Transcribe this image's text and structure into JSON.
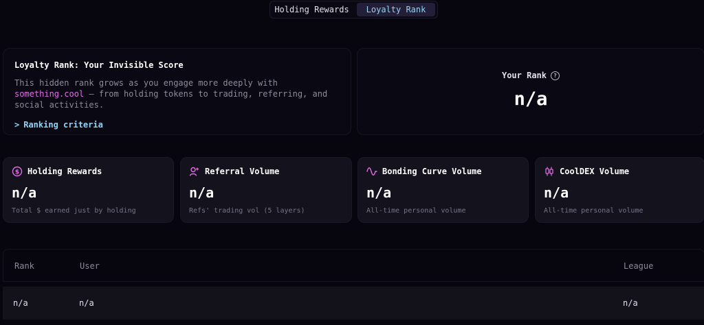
{
  "tabs": [
    {
      "label": "Holding Rewards",
      "active": false
    },
    {
      "label": "Loyalty Rank",
      "active": true
    }
  ],
  "intro": {
    "title": "Loyalty Rank: Your Invisible Score",
    "body_part1": "This hidden rank grows as you engage more deeply with ",
    "brand": "something.cool",
    "body_part2": " — from holding tokens to trading, referring, and social activities.",
    "criteria_prefix": ">",
    "criteria_label": "Ranking criteria"
  },
  "rank": {
    "label": "Your Rank",
    "help_icon": "?",
    "value": "n/a"
  },
  "stats": [
    {
      "icon": "dollar-circle-icon",
      "title": "Holding Rewards",
      "value": "n/a",
      "desc": "Total $ earned just by holding"
    },
    {
      "icon": "referral-user-icon",
      "title": "Referral Volume",
      "value": "n/a",
      "desc": "Refs' trading vol (5 layers)"
    },
    {
      "icon": "wave-icon",
      "title": "Bonding Curve Volume",
      "value": "n/a",
      "desc": "All-time personal volume"
    },
    {
      "icon": "candlestick-icon",
      "title": "CoolDEX Volume",
      "value": "n/a",
      "desc": "All-time personal volume"
    }
  ],
  "table": {
    "headers": {
      "rank": "Rank",
      "user": "User",
      "league": "League"
    },
    "rows": [
      {
        "rank": "n/a",
        "user": "n/a",
        "league": "n/a"
      }
    ]
  },
  "colors": {
    "accent_pink": "#e46be9",
    "accent_blue": "#8fd4f7",
    "background": "#07060e"
  }
}
